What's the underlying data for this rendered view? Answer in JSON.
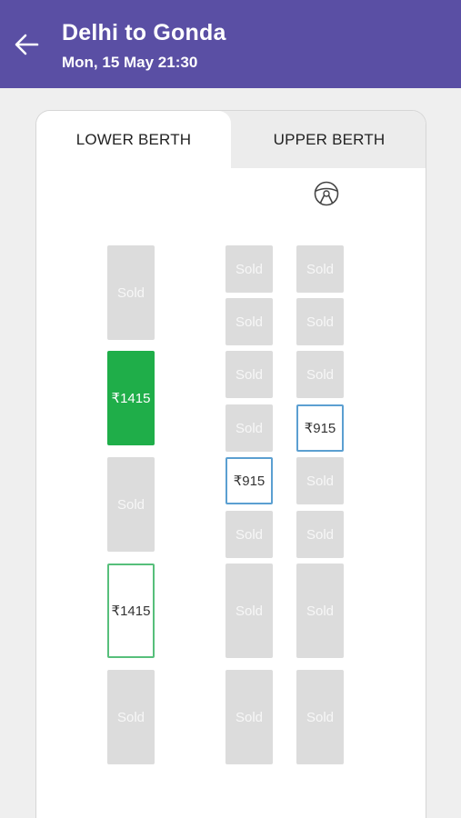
{
  "header": {
    "title": "Delhi to Gonda",
    "subtitle": "Mon, 15 May 21:30"
  },
  "tabs": {
    "lower": "LOWER BERTH",
    "upper": "UPPER BERTH",
    "active": "lower"
  },
  "colors": {
    "header_bg": "#5a4fa4",
    "sold": "#dcdcdc",
    "selected": "#1fae49",
    "available_sleeper_border": "#57bf7b",
    "available_seater_border": "#5b9fd1"
  },
  "seats": {
    "left_column": [
      {
        "label": "Sold",
        "status": "sold"
      },
      {
        "label": "₹1415",
        "status": "selected"
      },
      {
        "label": "Sold",
        "status": "sold"
      },
      {
        "label": "₹1415",
        "status": "available"
      },
      {
        "label": "Sold",
        "status": "sold"
      }
    ],
    "middle_column": [
      {
        "label": "Sold",
        "status": "sold"
      },
      {
        "label": "Sold",
        "status": "sold"
      },
      {
        "label": "Sold",
        "status": "sold"
      },
      {
        "label": "Sold",
        "status": "sold"
      },
      {
        "label": "₹915",
        "status": "available"
      },
      {
        "label": "Sold",
        "status": "sold"
      },
      {
        "label": "Sold",
        "status": "sold"
      },
      {
        "label": "Sold",
        "status": "sold"
      }
    ],
    "right_column": [
      {
        "label": "Sold",
        "status": "sold"
      },
      {
        "label": "Sold",
        "status": "sold"
      },
      {
        "label": "Sold",
        "status": "sold"
      },
      {
        "label": "₹915",
        "status": "available"
      },
      {
        "label": "Sold",
        "status": "sold"
      },
      {
        "label": "Sold",
        "status": "sold"
      },
      {
        "label": "Sold",
        "status": "sold"
      },
      {
        "label": "Sold",
        "status": "sold"
      }
    ]
  }
}
